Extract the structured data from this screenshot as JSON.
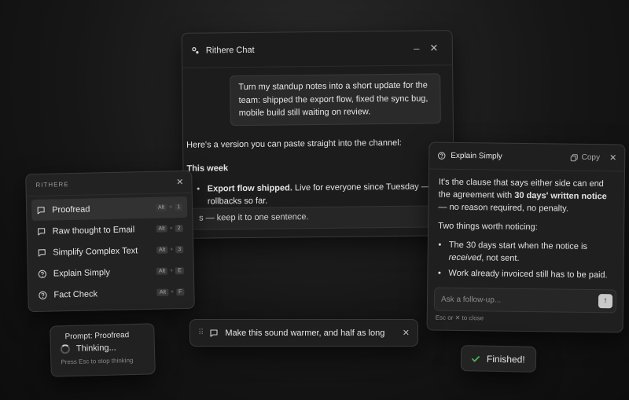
{
  "chat_window": {
    "title": "Rithere Chat",
    "minimize_label": "–",
    "close_label": "✕",
    "user_message": "Turn my standup notes into a short update for the team: shipped the export flow, fixed the sync bug, mobile build still waiting on review.",
    "assistant_intro": "Here's a version you can paste straight into the channel:",
    "assistant_heading": "This week",
    "bullet_bold": "Export flow shipped.",
    "bullet_text": " Live for everyone since Tuesday — n",
    "bullet_cont": "rollbacks so far.",
    "input_text": "s — keep it to one sentence."
  },
  "menu": {
    "title": "RITHERE",
    "close_label": "✕",
    "items": [
      {
        "label": "Proofread",
        "key1": "Alt",
        "plus": "+",
        "key2": "1",
        "icon": "chat-bubble-icon"
      },
      {
        "label": "Raw thought to Email",
        "key1": "Alt",
        "plus": "+",
        "key2": "2",
        "icon": "chat-bubble-icon"
      },
      {
        "label": "Simplify Complex Text",
        "key1": "Alt",
        "plus": "+",
        "key2": "3",
        "icon": "chat-bubble-icon"
      },
      {
        "label": "Explain Simply",
        "key1": "Alt",
        "plus": "+",
        "key2": "E",
        "icon": "question-circle-icon"
      },
      {
        "label": "Fact Check",
        "key1": "Alt",
        "plus": "+",
        "key2": "F",
        "icon": "question-circle-icon"
      }
    ]
  },
  "explain": {
    "title": "Explain Simply",
    "copy_label": "Copy",
    "close_label": "✕",
    "p1_a": "It's the clause that says either side can end the agreement with ",
    "p1_bold": "30 days' written notice",
    "p1_b": " — no reason required, no penalty.",
    "p2": "Two things worth noticing:",
    "b1_a": "The 30 days start when the notice is ",
    "b1_em": "received",
    "b1_b": ", not sent.",
    "b2": "Work already invoiced still has to be paid.",
    "followup_placeholder": "Ask a follow-up...",
    "send_icon": "↑",
    "hint": "Esc or ✕ to close"
  },
  "thinking": {
    "prompt_label": "Prompt: Proofread",
    "status": "Thinking...",
    "hint": "Press Esc to stop thinking"
  },
  "command_bar": {
    "grip": "⠿",
    "text": "Make this sound warmer, and half as long",
    "close_label": "✕"
  },
  "toast": {
    "text": "Finished!",
    "accent": "#4caf50"
  }
}
